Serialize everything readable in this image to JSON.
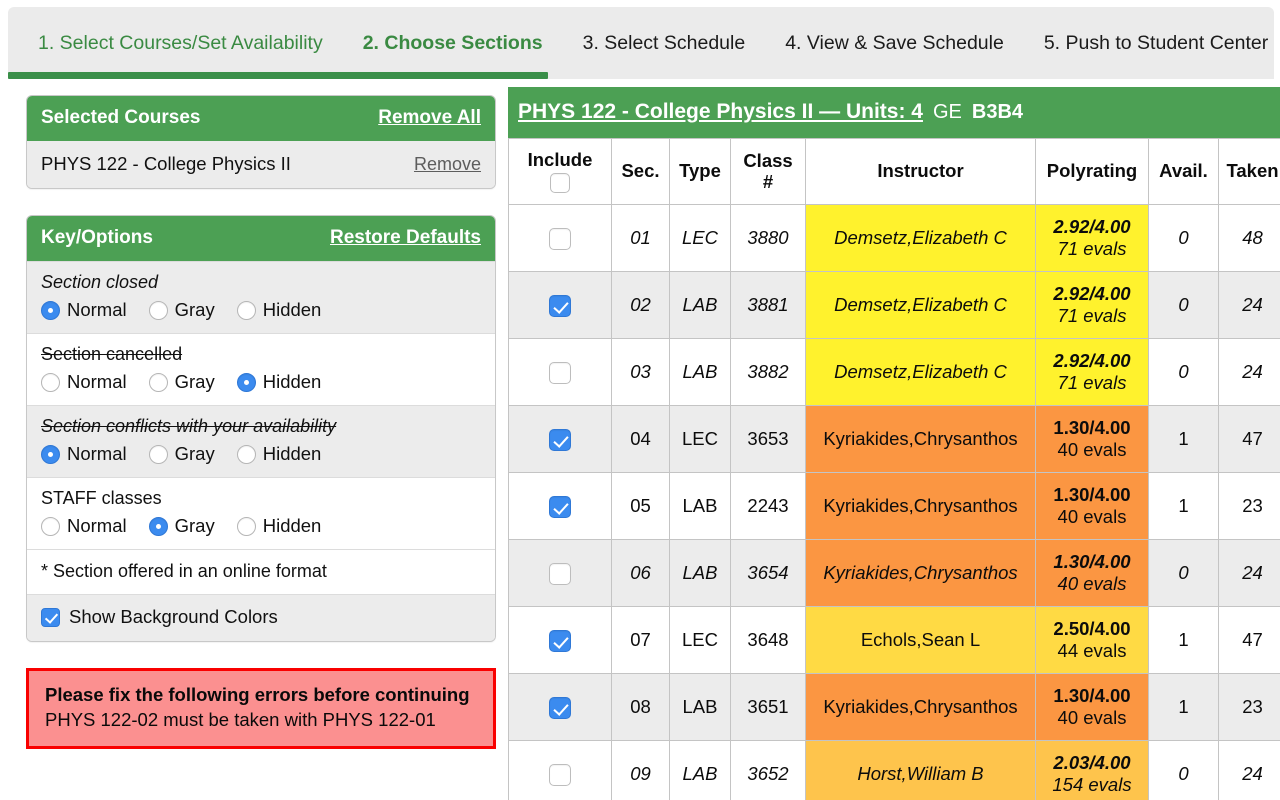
{
  "tabs": [
    {
      "label": "1. Select Courses/Set Availability",
      "state": "done"
    },
    {
      "label": "2. Choose Sections",
      "state": "current"
    },
    {
      "label": "3. Select Schedule",
      "state": "idle"
    },
    {
      "label": "4. View & Save Schedule",
      "state": "idle"
    },
    {
      "label": "5. Push to Student Center",
      "state": "idle"
    }
  ],
  "selected_courses": {
    "title": "Selected Courses",
    "remove_all_label": "Remove All",
    "items": [
      {
        "name": "PHYS 122 - College Physics II",
        "remove_label": "Remove"
      }
    ]
  },
  "key_options": {
    "title": "Key/Options",
    "restore_label": "Restore Defaults",
    "groups": [
      {
        "label": "Section closed",
        "style": "italic",
        "selected": "Normal",
        "choices": [
          "Normal",
          "Gray",
          "Hidden"
        ]
      },
      {
        "label": "Section cancelled",
        "style": "strike",
        "selected": "Hidden",
        "choices": [
          "Normal",
          "Gray",
          "Hidden"
        ]
      },
      {
        "label": "Section conflicts with your availability",
        "style": "italic-strike",
        "selected": "Normal",
        "choices": [
          "Normal",
          "Gray",
          "Hidden"
        ]
      },
      {
        "label": "STAFF classes",
        "style": "plain",
        "selected": "Gray",
        "choices": [
          "Normal",
          "Gray",
          "Hidden"
        ]
      }
    ],
    "online_note": "* Section offered in an online format",
    "show_bg_label": "Show Background Colors",
    "show_bg_checked": true
  },
  "error_panel": {
    "title": "Please fix the following errors before continuing",
    "messages": [
      "PHYS 122-02 must be taken with PHYS 122-01"
    ],
    "border_color": "#f90000",
    "background_color": "#fb9090"
  },
  "course_panel": {
    "title": "PHYS 122 - College Physics II — Units: 4",
    "ge_label": "GE",
    "ge_code": "B3B4",
    "header_color": "#4ca054",
    "columns": [
      "Include",
      "Sec.",
      "Type",
      "Class #",
      "Instructor",
      "Polyrating",
      "Avail.",
      "Taken"
    ],
    "column_labels": {
      "include": "Include",
      "sec": "Sec.",
      "type": "Type",
      "class_num_line1": "Class",
      "class_num_line2": "#",
      "instructor": "Instructor",
      "polyrating": "Polyrating",
      "avail": "Avail.",
      "taken": "Taken"
    },
    "select_all_checked": false,
    "rows": [
      {
        "include": false,
        "sec": "01",
        "type": "LEC",
        "class_num": "3880",
        "instructor": "Demsetz,Elizabeth C",
        "rating_score": "2.92/4.00",
        "rating_evals": "71 evals",
        "avail": "0",
        "taken": "48",
        "closed": true,
        "color": "#fff22d",
        "stripe": false
      },
      {
        "include": true,
        "sec": "02",
        "type": "LAB",
        "class_num": "3881",
        "instructor": "Demsetz,Elizabeth C",
        "rating_score": "2.92/4.00",
        "rating_evals": "71 evals",
        "avail": "0",
        "taken": "24",
        "closed": true,
        "color": "#fff22d",
        "stripe": true
      },
      {
        "include": false,
        "sec": "03",
        "type": "LAB",
        "class_num": "3882",
        "instructor": "Demsetz,Elizabeth C",
        "rating_score": "2.92/4.00",
        "rating_evals": "71 evals",
        "avail": "0",
        "taken": "24",
        "closed": true,
        "color": "#fff22d",
        "stripe": false
      },
      {
        "include": true,
        "sec": "04",
        "type": "LEC",
        "class_num": "3653",
        "instructor": "Kyriakides,Chrysanthos",
        "rating_score": "1.30/4.00",
        "rating_evals": "40 evals",
        "avail": "1",
        "taken": "47",
        "closed": false,
        "color": "#fb9642",
        "stripe": true
      },
      {
        "include": true,
        "sec": "05",
        "type": "LAB",
        "class_num": "2243",
        "instructor": "Kyriakides,Chrysanthos",
        "rating_score": "1.30/4.00",
        "rating_evals": "40 evals",
        "avail": "1",
        "taken": "23",
        "closed": false,
        "color": "#fb9642",
        "stripe": false
      },
      {
        "include": false,
        "sec": "06",
        "type": "LAB",
        "class_num": "3654",
        "instructor": "Kyriakides,Chrysanthos",
        "rating_score": "1.30/4.00",
        "rating_evals": "40 evals",
        "avail": "0",
        "taken": "24",
        "closed": true,
        "color": "#fb9642",
        "stripe": true
      },
      {
        "include": true,
        "sec": "07",
        "type": "LEC",
        "class_num": "3648",
        "instructor": "Echols,Sean L",
        "rating_score": "2.50/4.00",
        "rating_evals": "44 evals",
        "avail": "1",
        "taken": "47",
        "closed": false,
        "color": "#ffda44",
        "stripe": false
      },
      {
        "include": true,
        "sec": "08",
        "type": "LAB",
        "class_num": "3651",
        "instructor": "Kyriakides,Chrysanthos",
        "rating_score": "1.30/4.00",
        "rating_evals": "40 evals",
        "avail": "1",
        "taken": "23",
        "closed": false,
        "color": "#fb9642",
        "stripe": true
      },
      {
        "include": false,
        "sec": "09",
        "type": "LAB",
        "class_num": "3652",
        "instructor": "Horst,William B",
        "rating_score": "2.03/4.00",
        "rating_evals": "154 evals",
        "avail": "0",
        "taken": "24",
        "closed": true,
        "color": "#fec44c",
        "stripe": false
      }
    ]
  }
}
